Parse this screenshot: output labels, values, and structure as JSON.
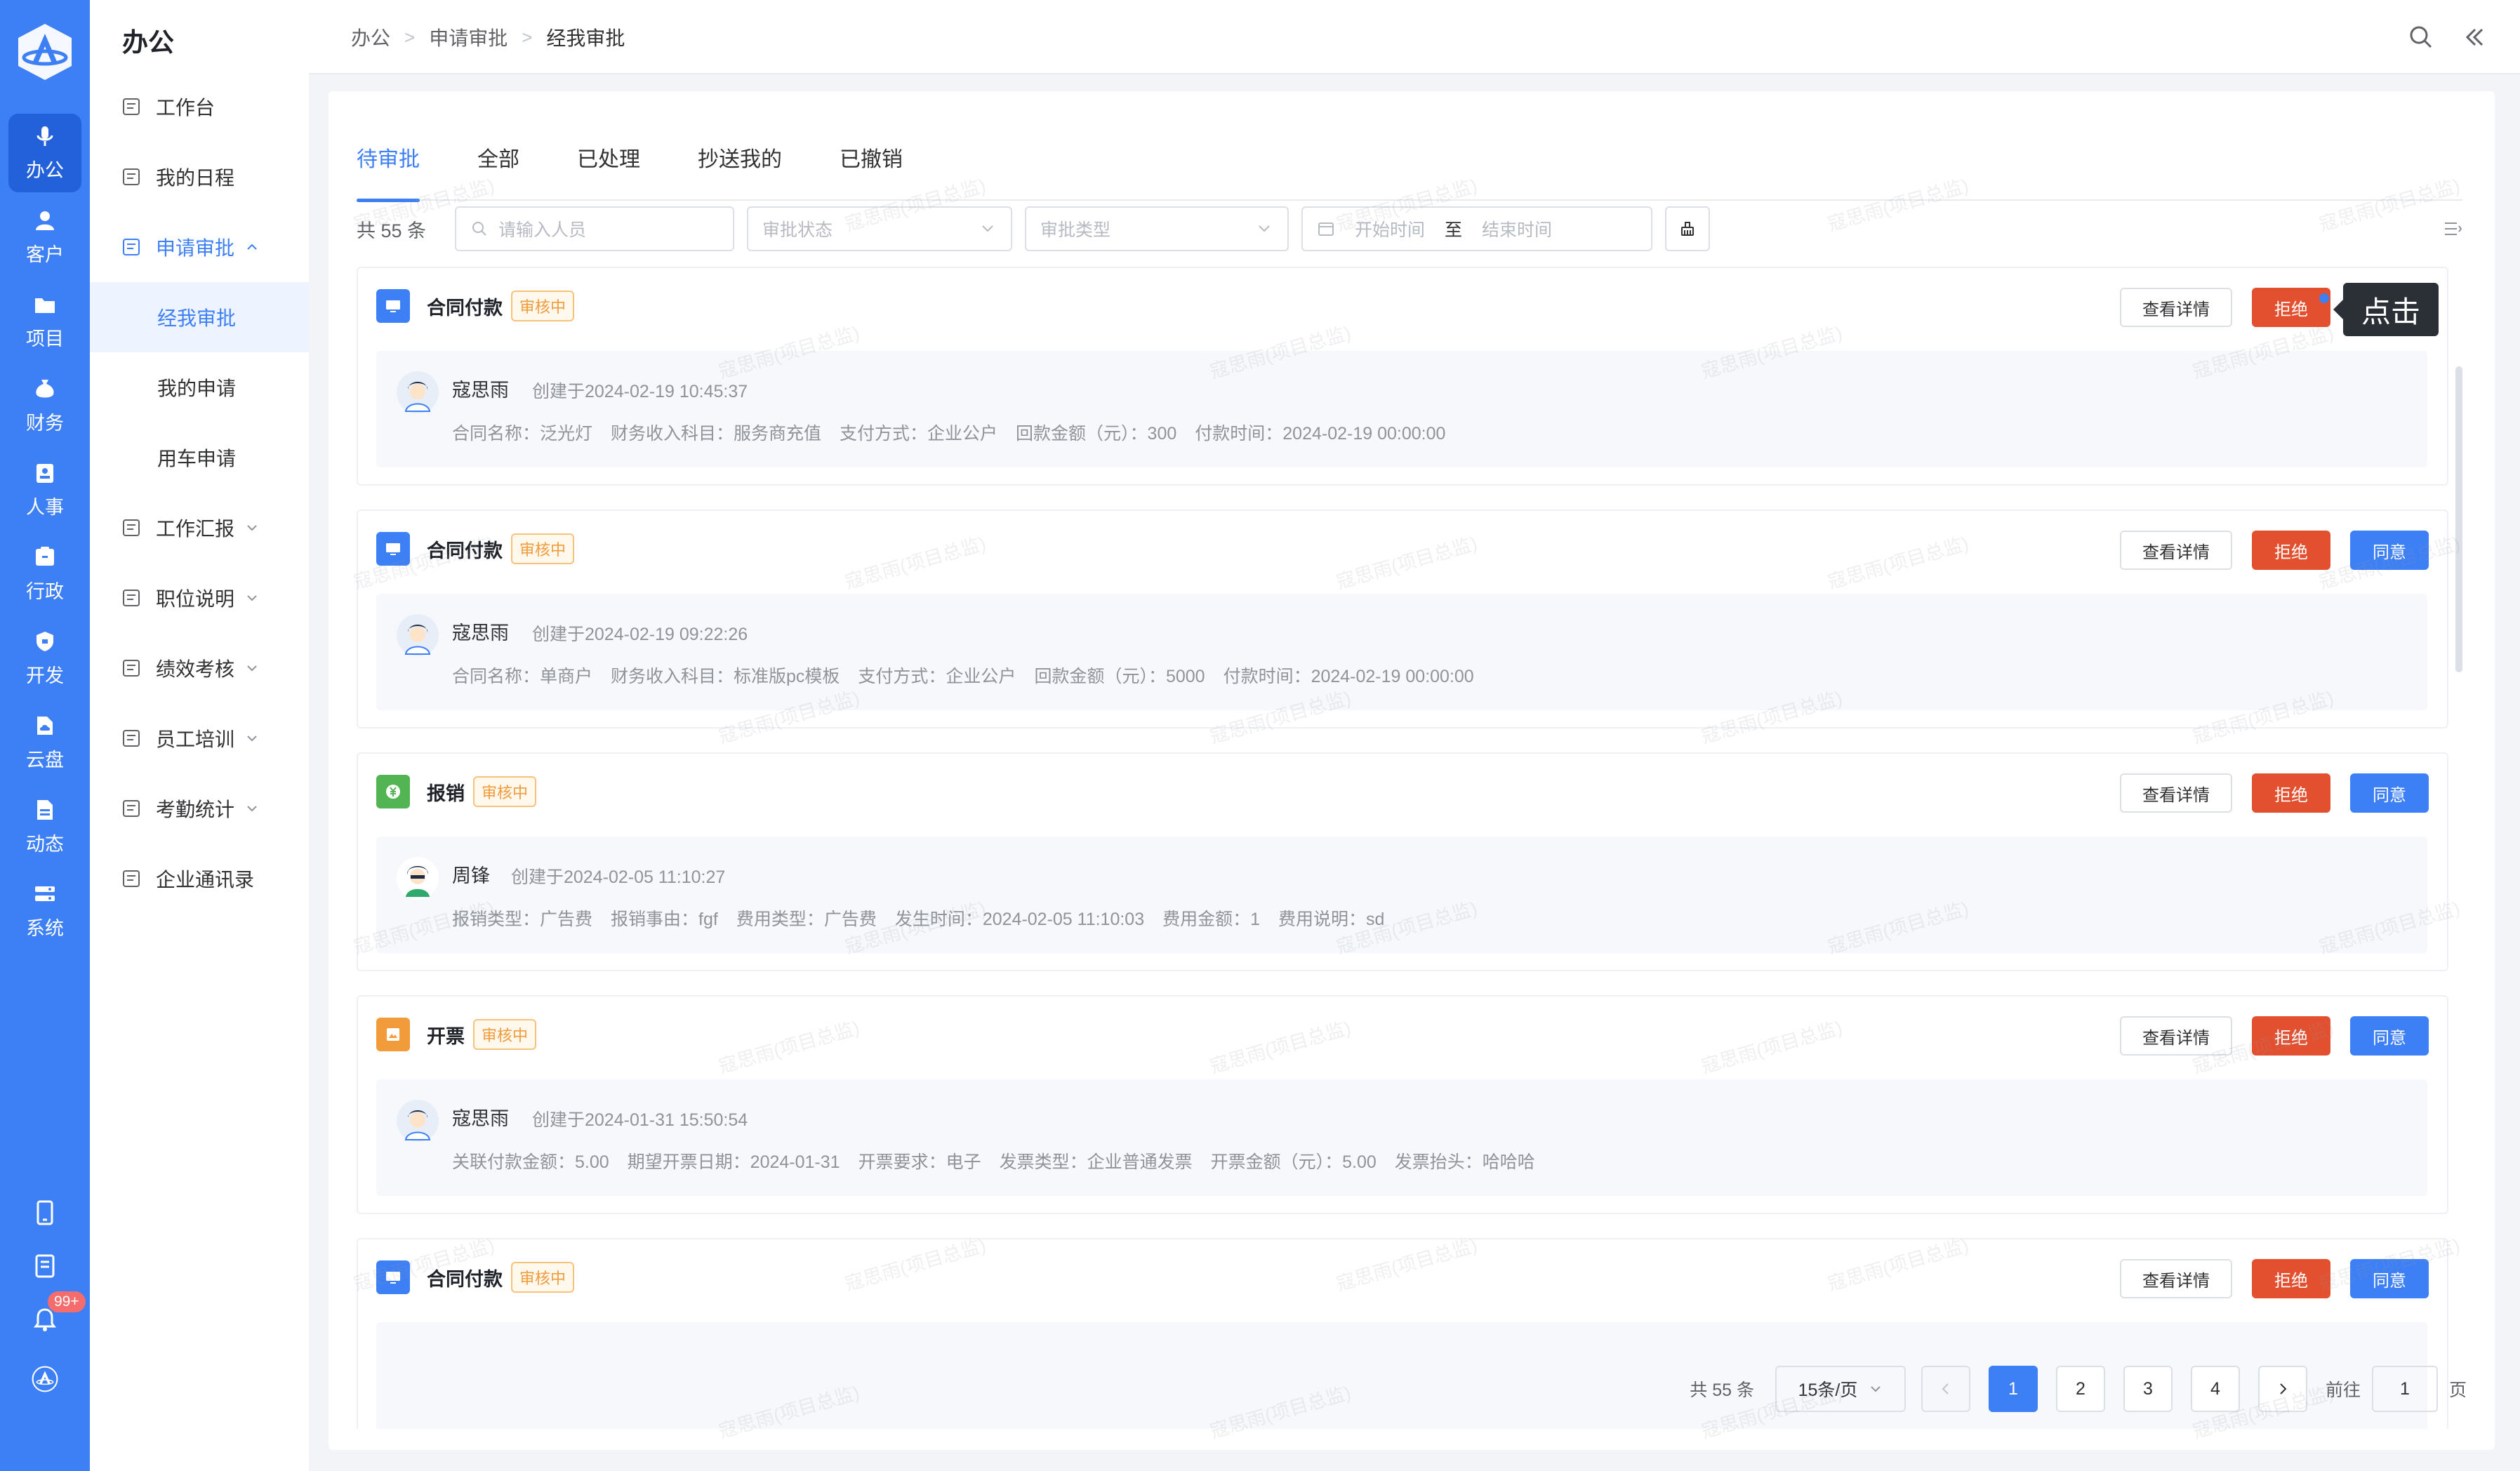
{
  "rail": {
    "items": [
      {
        "label": "办公",
        "icon": "mic-icon",
        "active": true
      },
      {
        "label": "客户",
        "icon": "customer-icon"
      },
      {
        "label": "项目",
        "icon": "folder-icon"
      },
      {
        "label": "财务",
        "icon": "money-bag-icon"
      },
      {
        "label": "人事",
        "icon": "id-card-icon"
      },
      {
        "label": "行政",
        "icon": "admin-icon"
      },
      {
        "label": "开发",
        "icon": "shield-icon"
      },
      {
        "label": "云盘",
        "icon": "cloud-disk-icon"
      },
      {
        "label": "动态",
        "icon": "news-icon"
      },
      {
        "label": "系统",
        "icon": "system-icon"
      }
    ],
    "notification_badge": "99+"
  },
  "sidebar": {
    "title": "办公",
    "items": [
      {
        "label": "工作台",
        "icon": "desktop-icon"
      },
      {
        "label": "我的日程",
        "icon": "calendar-icon"
      },
      {
        "label": "申请审批",
        "icon": "approval-icon",
        "expanded": true
      },
      {
        "label": "经我审批",
        "sub": true,
        "active": true
      },
      {
        "label": "我的申请",
        "sub": true
      },
      {
        "label": "用车申请",
        "sub": true
      },
      {
        "label": "工作汇报",
        "icon": "report-icon",
        "chevron": true
      },
      {
        "label": "职位说明",
        "icon": "position-icon",
        "chevron": true
      },
      {
        "label": "绩效考核",
        "icon": "performance-icon",
        "chevron": true
      },
      {
        "label": "员工培训",
        "icon": "training-icon",
        "chevron": true
      },
      {
        "label": "考勤统计",
        "icon": "attendance-icon",
        "chevron": true
      },
      {
        "label": "企业通讯录",
        "icon": "contacts-icon"
      }
    ]
  },
  "breadcrumb": [
    "办公",
    "申请审批",
    "经我审批"
  ],
  "tabs": [
    "待审批",
    "全部",
    "已处理",
    "抄送我的",
    "已撤销"
  ],
  "filters": {
    "total": "共 55 条",
    "person_placeholder": "请输入人员",
    "status_placeholder": "审批状态",
    "type_placeholder": "审批类型",
    "start_placeholder": "开始时间",
    "range_sep": "至",
    "end_placeholder": "结束时间"
  },
  "buttons": {
    "detail": "查看详情",
    "reject": "拒绝",
    "approve": "同意"
  },
  "cards": [
    {
      "title": "合同付款",
      "status": "审核中",
      "icon": "monitor-icon",
      "icon_color": "#3d7ff5",
      "applicant": "寇思雨",
      "created": "创建于2024-02-19 10:45:37",
      "details": [
        "合同名称：泛光灯",
        "财务收入科目：服务商充值",
        "支付方式：企业公户",
        "回款金额（元）：300",
        "付款时间：2024-02-19 00:00:00"
      ],
      "show_approve": false
    },
    {
      "title": "合同付款",
      "status": "审核中",
      "icon": "monitor-icon",
      "icon_color": "#3d7ff5",
      "applicant": "寇思雨",
      "created": "创建于2024-02-19 09:22:26",
      "details": [
        "合同名称：单商户",
        "财务收入科目：标准版pc模板",
        "支付方式：企业公户",
        "回款金额（元）：5000",
        "付款时间：2024-02-19 00:00:00"
      ],
      "show_approve": true
    },
    {
      "title": "报销",
      "status": "审核中",
      "icon": "yen-icon",
      "icon_color": "#52b452",
      "applicant": "周锋",
      "created": "创建于2024-02-05 11:10:27",
      "details": [
        "报销类型：广告费",
        "报销事由：fgf",
        "费用类型：广告费",
        "发生时间：2024-02-05 11:10:03",
        "费用金额：1",
        "费用说明：sd"
      ],
      "show_approve": true
    },
    {
      "title": "开票",
      "status": "审核中",
      "icon": "invoice-icon",
      "icon_color": "#f29b3a",
      "applicant": "寇思雨",
      "created": "创建于2024-01-31 15:50:54",
      "details": [
        "关联付款金额：5.00",
        "期望开票日期：2024-01-31",
        "开票要求：电子",
        "发票类型：企业普通发票",
        "开票金额（元）：5.00",
        "发票抬头：哈哈哈"
      ],
      "show_approve": true
    },
    {
      "title": "合同付款",
      "status": "审核中",
      "icon": "monitor-icon",
      "icon_color": "#3d7ff5",
      "applicant": "",
      "created": "",
      "details": [],
      "show_approve": true
    }
  ],
  "tooltip": "点击",
  "pagination": {
    "total": "共 55 条",
    "page_size": "15条/页",
    "pages": [
      "1",
      "2",
      "3",
      "4"
    ],
    "current": "1",
    "goto_label": "前往",
    "goto_value": "1",
    "page_suffix": "页"
  },
  "watermark": "寇思雨(项目总监)"
}
